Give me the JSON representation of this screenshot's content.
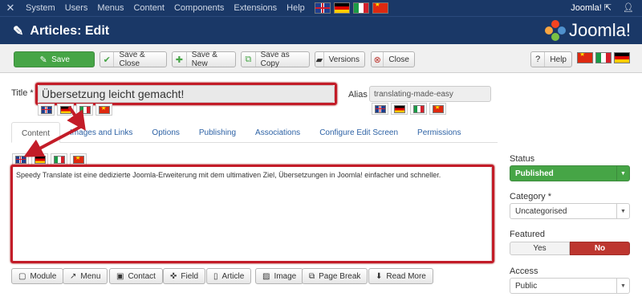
{
  "topnav": {
    "items": [
      "System",
      "Users",
      "Menus",
      "Content",
      "Components",
      "Extensions",
      "Help"
    ],
    "site_link": "Joomla! ⇱",
    "user_icon": "user-icon",
    "flags": [
      "uk",
      "de",
      "it",
      "cn"
    ]
  },
  "header": {
    "title": "Articles: Edit",
    "brand": "Joomla!"
  },
  "toolbar": {
    "save": "Save",
    "save_close": "Save & Close",
    "save_new": "Save & New",
    "save_copy": "Save as Copy",
    "versions": "Versions",
    "close": "Close",
    "help": "Help"
  },
  "form": {
    "title_label": "Title *",
    "title_value": "Übersetzung leicht gemacht!",
    "alias_label": "Alias",
    "alias_value": "translating-made-easy"
  },
  "tabs": [
    "Content",
    "Images and Links",
    "Options",
    "Publishing",
    "Associations",
    "Configure Edit Screen",
    "Permissions"
  ],
  "editor": {
    "text": "Speedy Translate ist eine dedizierte Joomla-Erweiterung mit dem ultimativen Ziel, Übersetzungen in Joomla! einfacher und schneller."
  },
  "editor_buttons": [
    "Module",
    "Menu",
    "Contact",
    "Field",
    "Article",
    "Image",
    "Page Break",
    "Read More"
  ],
  "sidebar": {
    "status_label": "Status",
    "status_value": "Published",
    "category_label": "Category *",
    "category_value": "Uncategorised",
    "featured_label": "Featured",
    "featured_yes": "Yes",
    "featured_no": "No",
    "access_label": "Access",
    "access_value": "Public"
  },
  "colors": {
    "nav_bg": "#1a3867",
    "green": "#46a546",
    "red": "#bd362f",
    "annotation": "#c31c28"
  }
}
